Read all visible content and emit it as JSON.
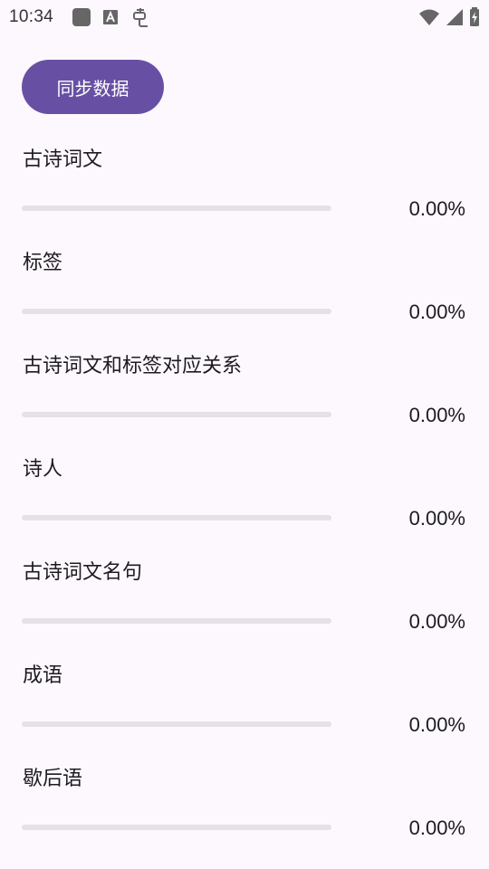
{
  "status_bar": {
    "time": "10:34",
    "left_icons": [
      "square-app-icon",
      "font-a-icon",
      "bug-icon"
    ],
    "right_icons": [
      "wifi-icon",
      "cell-signal-icon",
      "battery-charging-icon"
    ]
  },
  "sync_button": {
    "label": "同步数据"
  },
  "accent_color": "#6750a4",
  "items": [
    {
      "label": "古诗词文",
      "percent_text": "0.00%",
      "progress": 0
    },
    {
      "label": "标签",
      "percent_text": "0.00%",
      "progress": 0
    },
    {
      "label": "古诗词文和标签对应关系",
      "percent_text": "0.00%",
      "progress": 0
    },
    {
      "label": "诗人",
      "percent_text": "0.00%",
      "progress": 0
    },
    {
      "label": "古诗词文名句",
      "percent_text": "0.00%",
      "progress": 0
    },
    {
      "label": "成语",
      "percent_text": "0.00%",
      "progress": 0
    },
    {
      "label": "歇后语",
      "percent_text": "0.00%",
      "progress": 0
    }
  ]
}
